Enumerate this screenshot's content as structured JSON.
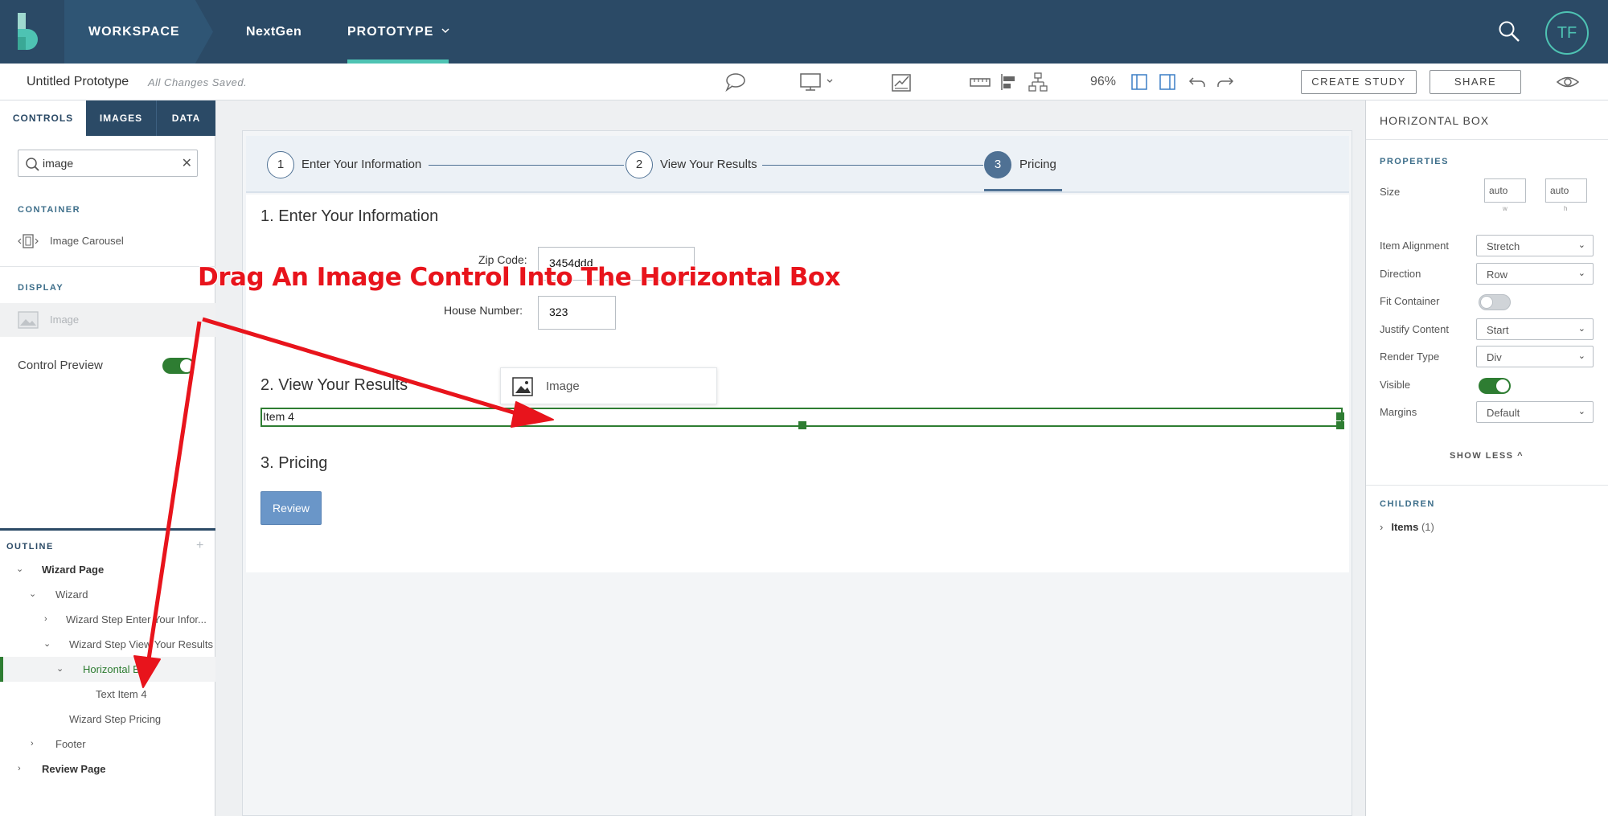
{
  "topbar": {
    "workspace": "WORKSPACE",
    "nextgen": "NextGen",
    "prototype": "PROTOTYPE",
    "avatar_initials": "TF",
    "accent": "#4ec3b3",
    "bg": "#2b4a66"
  },
  "toolbar": {
    "title": "Untitled Prototype",
    "status": "All Changes Saved.",
    "zoom": "96%",
    "create_study": "CREATE STUDY",
    "share": "SHARE"
  },
  "left_panel": {
    "tabs": [
      "CONTROLS",
      "IMAGES",
      "DATA"
    ],
    "active_tab": "CONTROLS",
    "search_value": "image",
    "container_label": "CONTAINER",
    "container_item": "Image Carousel",
    "display_label": "DISPLAY",
    "display_item": "Image",
    "control_preview": "Control Preview",
    "control_preview_on": true,
    "outline_label": "OUTLINE",
    "outline": [
      "Wizard Page",
      "Wizard",
      "Wizard Step Enter Your Infor...",
      "Wizard Step View Your Results",
      "Horizontal Box",
      "Text Item 4",
      "Wizard Step Pricing",
      "Footer",
      "Review Page"
    ]
  },
  "canvas": {
    "steps": [
      {
        "num": "1",
        "label": "Enter Your Information"
      },
      {
        "num": "2",
        "label": "View Your Results"
      },
      {
        "num": "3",
        "label": "Pricing"
      }
    ],
    "active_step": 3,
    "section1_title": "1. Enter Your Information",
    "zip_label": "Zip Code:",
    "zip_value": "3454ddd",
    "house_label": "House Number:",
    "house_value": "323",
    "section2_title": "2. View Your Results",
    "hbox_item": "Item 4",
    "section3_title": "3. Pricing",
    "review_button": "Review",
    "drag_ghost_label": "Image"
  },
  "right_panel": {
    "title": "HORIZONTAL BOX",
    "properties_label": "PROPERTIES",
    "size_label": "Size",
    "size_w": "auto",
    "size_h": "auto",
    "size_w_sub": "w",
    "size_h_sub": "h",
    "item_alignment_label": "Item Alignment",
    "item_alignment": "Stretch",
    "direction_label": "Direction",
    "direction": "Row",
    "fit_container_label": "Fit Container",
    "fit_container_on": false,
    "justify_label": "Justify Content",
    "justify": "Start",
    "render_type_label": "Render Type",
    "render_type": "Div",
    "visible_label": "Visible",
    "visible_on": true,
    "margins_label": "Margins",
    "margins": "Default",
    "show_less": "SHOW LESS",
    "children_label": "CHILDREN",
    "children_items": "Items",
    "children_count": "(1)"
  },
  "annotation": {
    "text": "Drag An Image Control Into The Horizontal Box",
    "color": "#e8141c"
  }
}
